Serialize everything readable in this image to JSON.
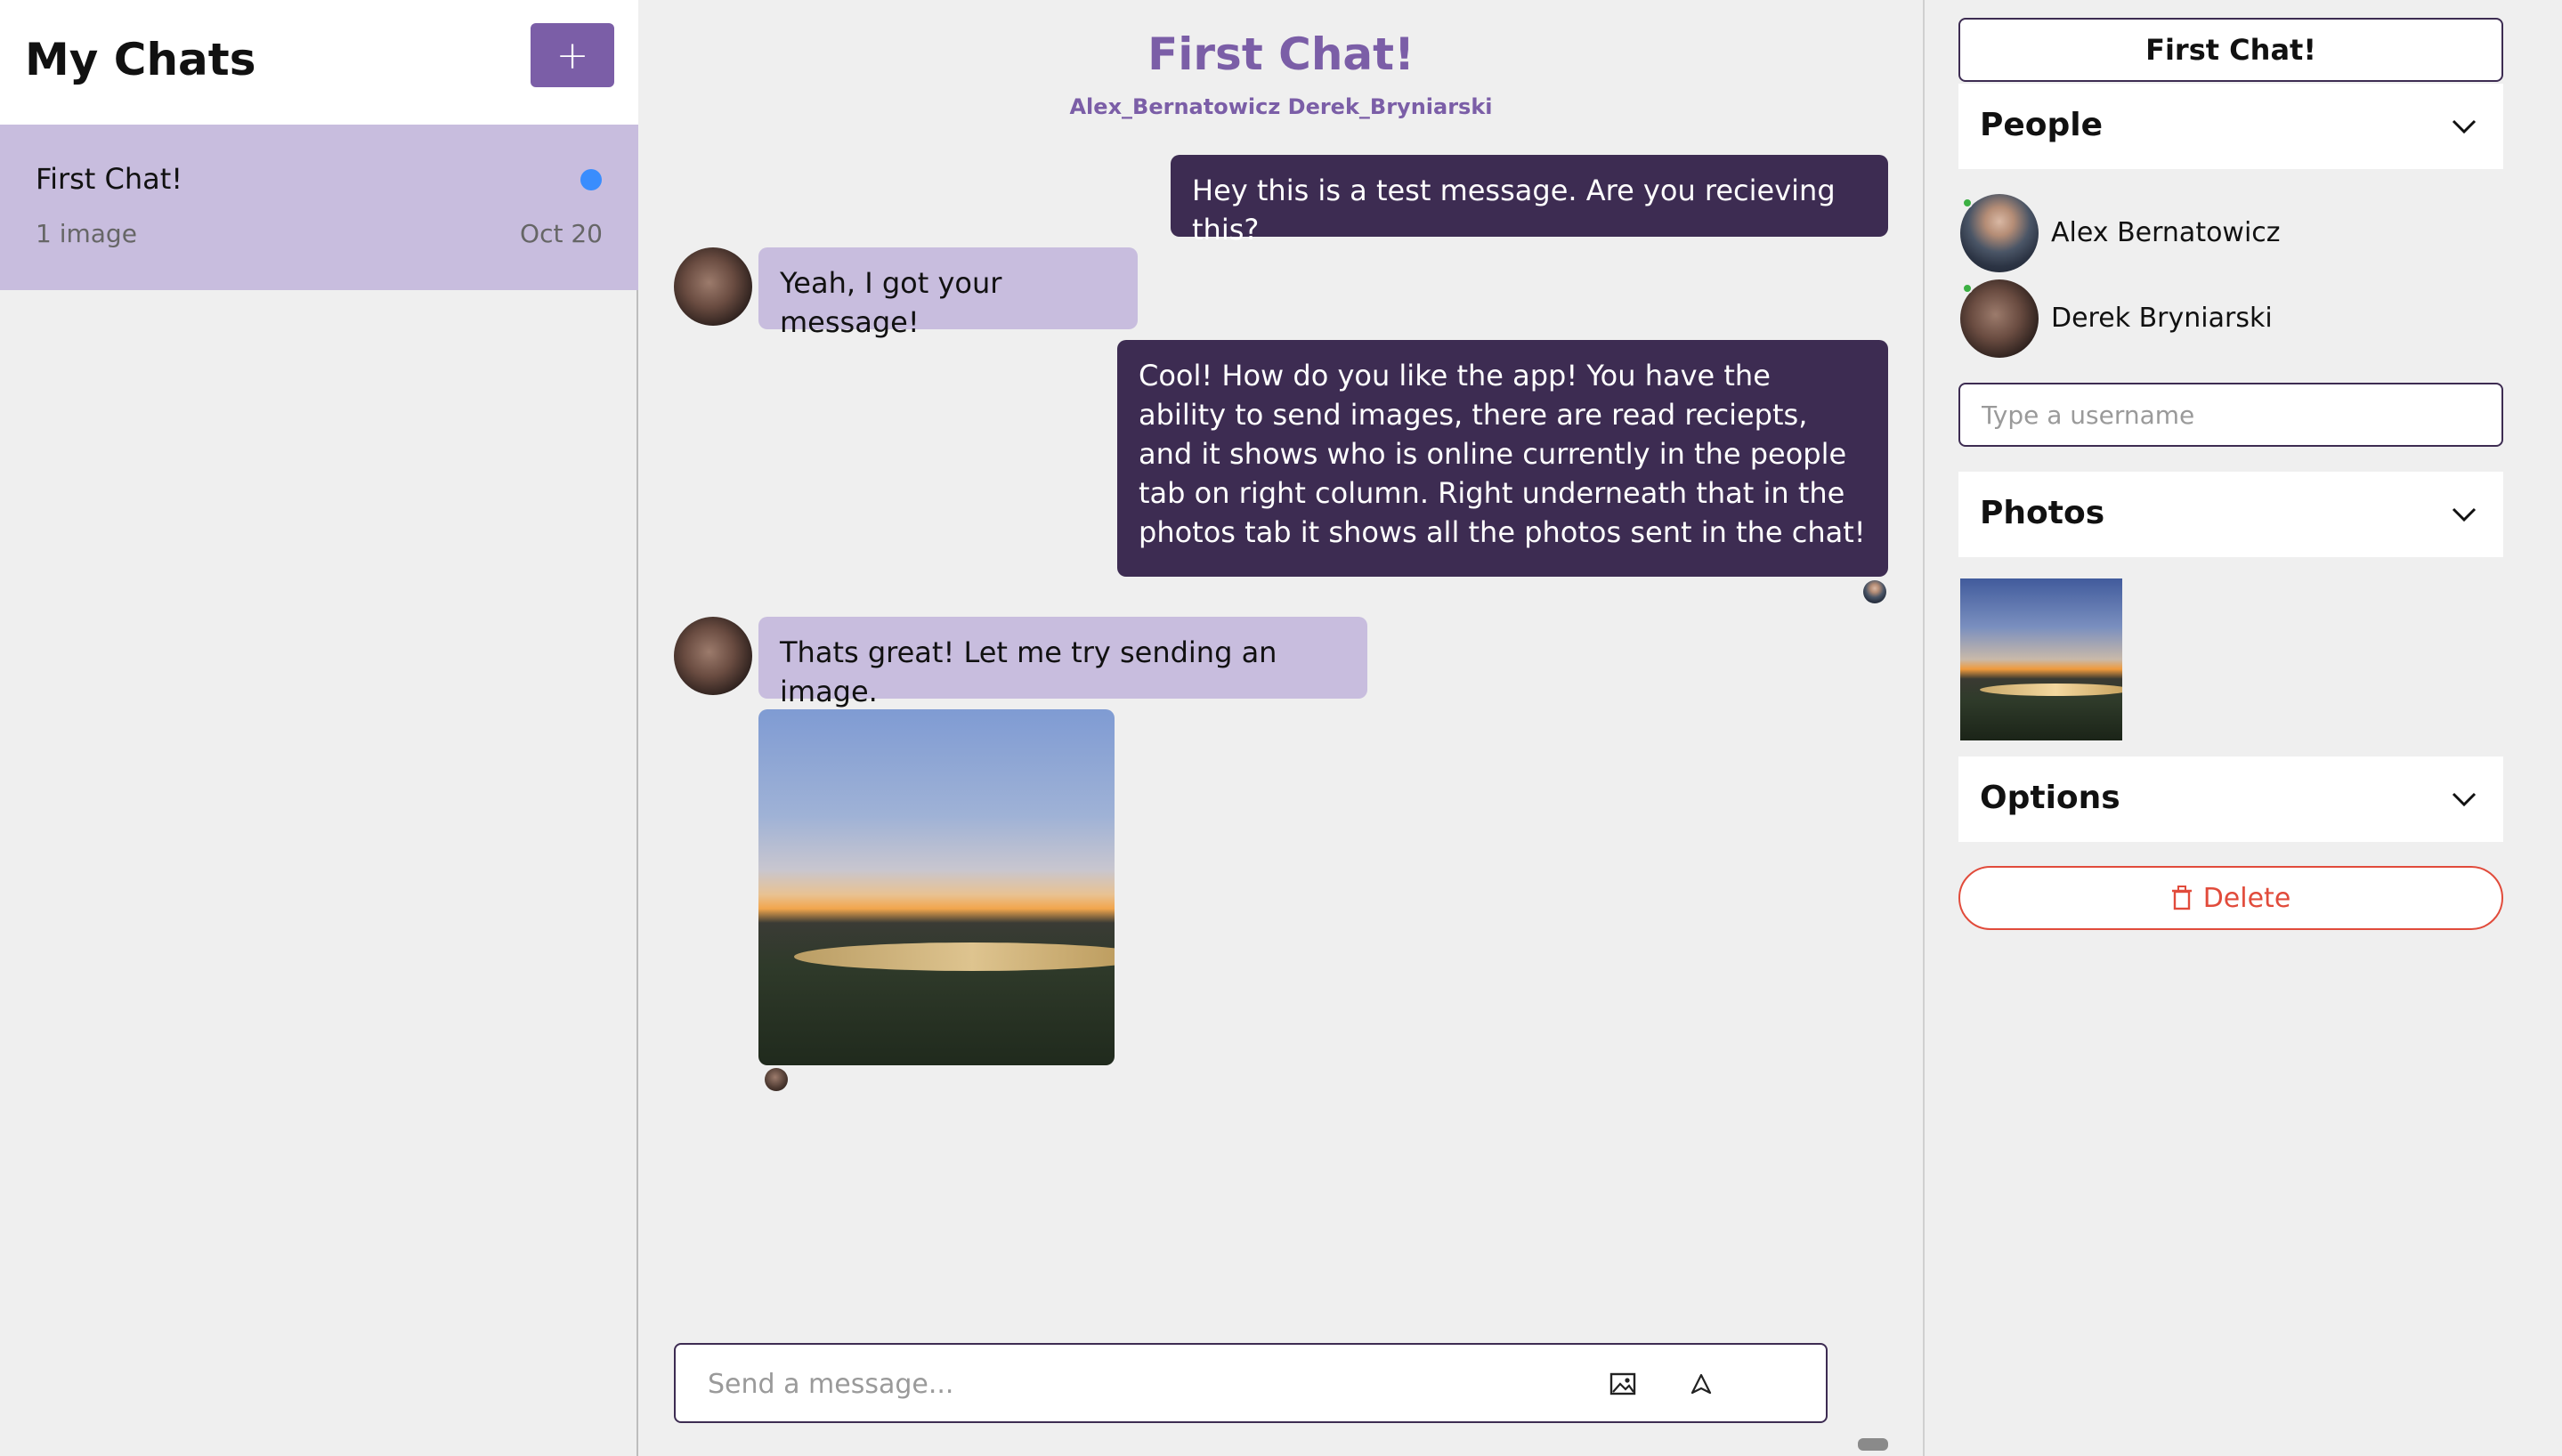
{
  "sidebar": {
    "title": "My Chats",
    "new_chat_label": "+",
    "chats": [
      {
        "title": "First Chat!",
        "subtitle": "1 image",
        "date": "Oct 20",
        "unread": true
      }
    ]
  },
  "chat": {
    "title": "First Chat!",
    "members": "Alex_Bernatowicz Derek_Bryniarski",
    "messages": [
      {
        "from": "me",
        "text": "Hey this is a test message. Are you recieving this?"
      },
      {
        "from": "Derek Bryniarski",
        "text": "Yeah, I got your message!"
      },
      {
        "from": "me",
        "text": "Cool! How do you like the app! You have the ability to send images, there are read reciepts, and it shows who is online currently in the people tab on right column. Right underneath that in the photos tab it shows all the photos sent in the chat!"
      },
      {
        "from": "Derek Bryniarski",
        "text": "Thats great! Let me try sending an image."
      },
      {
        "from": "Derek Bryniarski",
        "type": "image",
        "icon": "sunset-photo"
      }
    ],
    "input": {
      "placeholder": "Send a message...",
      "value": ""
    },
    "icons": {
      "attach": "image-icon",
      "send": "send-icon"
    }
  },
  "settings": {
    "chat_title": "First Chat!",
    "people": {
      "label": "People",
      "members": [
        {
          "name": "Alex Bernatowicz",
          "online": true
        },
        {
          "name": "Derek Bryniarski",
          "online": true
        }
      ],
      "add_placeholder": "Type a username"
    },
    "photos": {
      "label": "Photos"
    },
    "options": {
      "label": "Options"
    },
    "delete_label": "Delete"
  },
  "colors": {
    "accent": "#7b5ea7",
    "own_bubble": "#3d2c52",
    "other_bubble": "#c8bdde",
    "unread_dot": "#3a8dfd",
    "danger": "#e14b3b",
    "online": "#3cb043"
  }
}
